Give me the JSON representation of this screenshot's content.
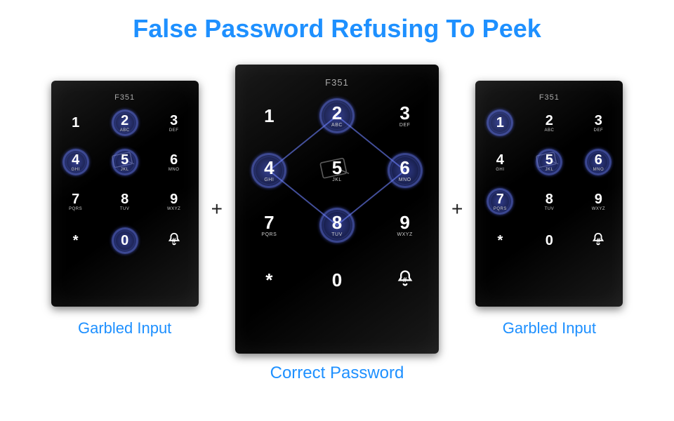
{
  "title": "False Password  Refusing To Peek",
  "plus_symbol": "+",
  "model_label": "F351",
  "captions": {
    "left": "Garbled Input",
    "center": "Correct Password",
    "right": "Garbled Input"
  },
  "keys": [
    {
      "digit": "1",
      "sub": ""
    },
    {
      "digit": "2",
      "sub": "ABC"
    },
    {
      "digit": "3",
      "sub": "DEF"
    },
    {
      "digit": "4",
      "sub": "GHI"
    },
    {
      "digit": "5",
      "sub": "JKL"
    },
    {
      "digit": "6",
      "sub": "MNO"
    },
    {
      "digit": "7",
      "sub": "PQRS"
    },
    {
      "digit": "8",
      "sub": "TUV"
    },
    {
      "digit": "9",
      "sub": "WXYZ"
    },
    {
      "digit": "*",
      "sub": ""
    },
    {
      "digit": "0",
      "sub": ""
    },
    {
      "digit": "#",
      "sub": "",
      "bell": true
    }
  ],
  "highlights": {
    "left": [
      1,
      3,
      4,
      10
    ],
    "center": [
      1,
      3,
      5,
      7
    ],
    "right": [
      0,
      4,
      5,
      6
    ]
  },
  "card_icon_after_index": 4,
  "center_lines": true
}
